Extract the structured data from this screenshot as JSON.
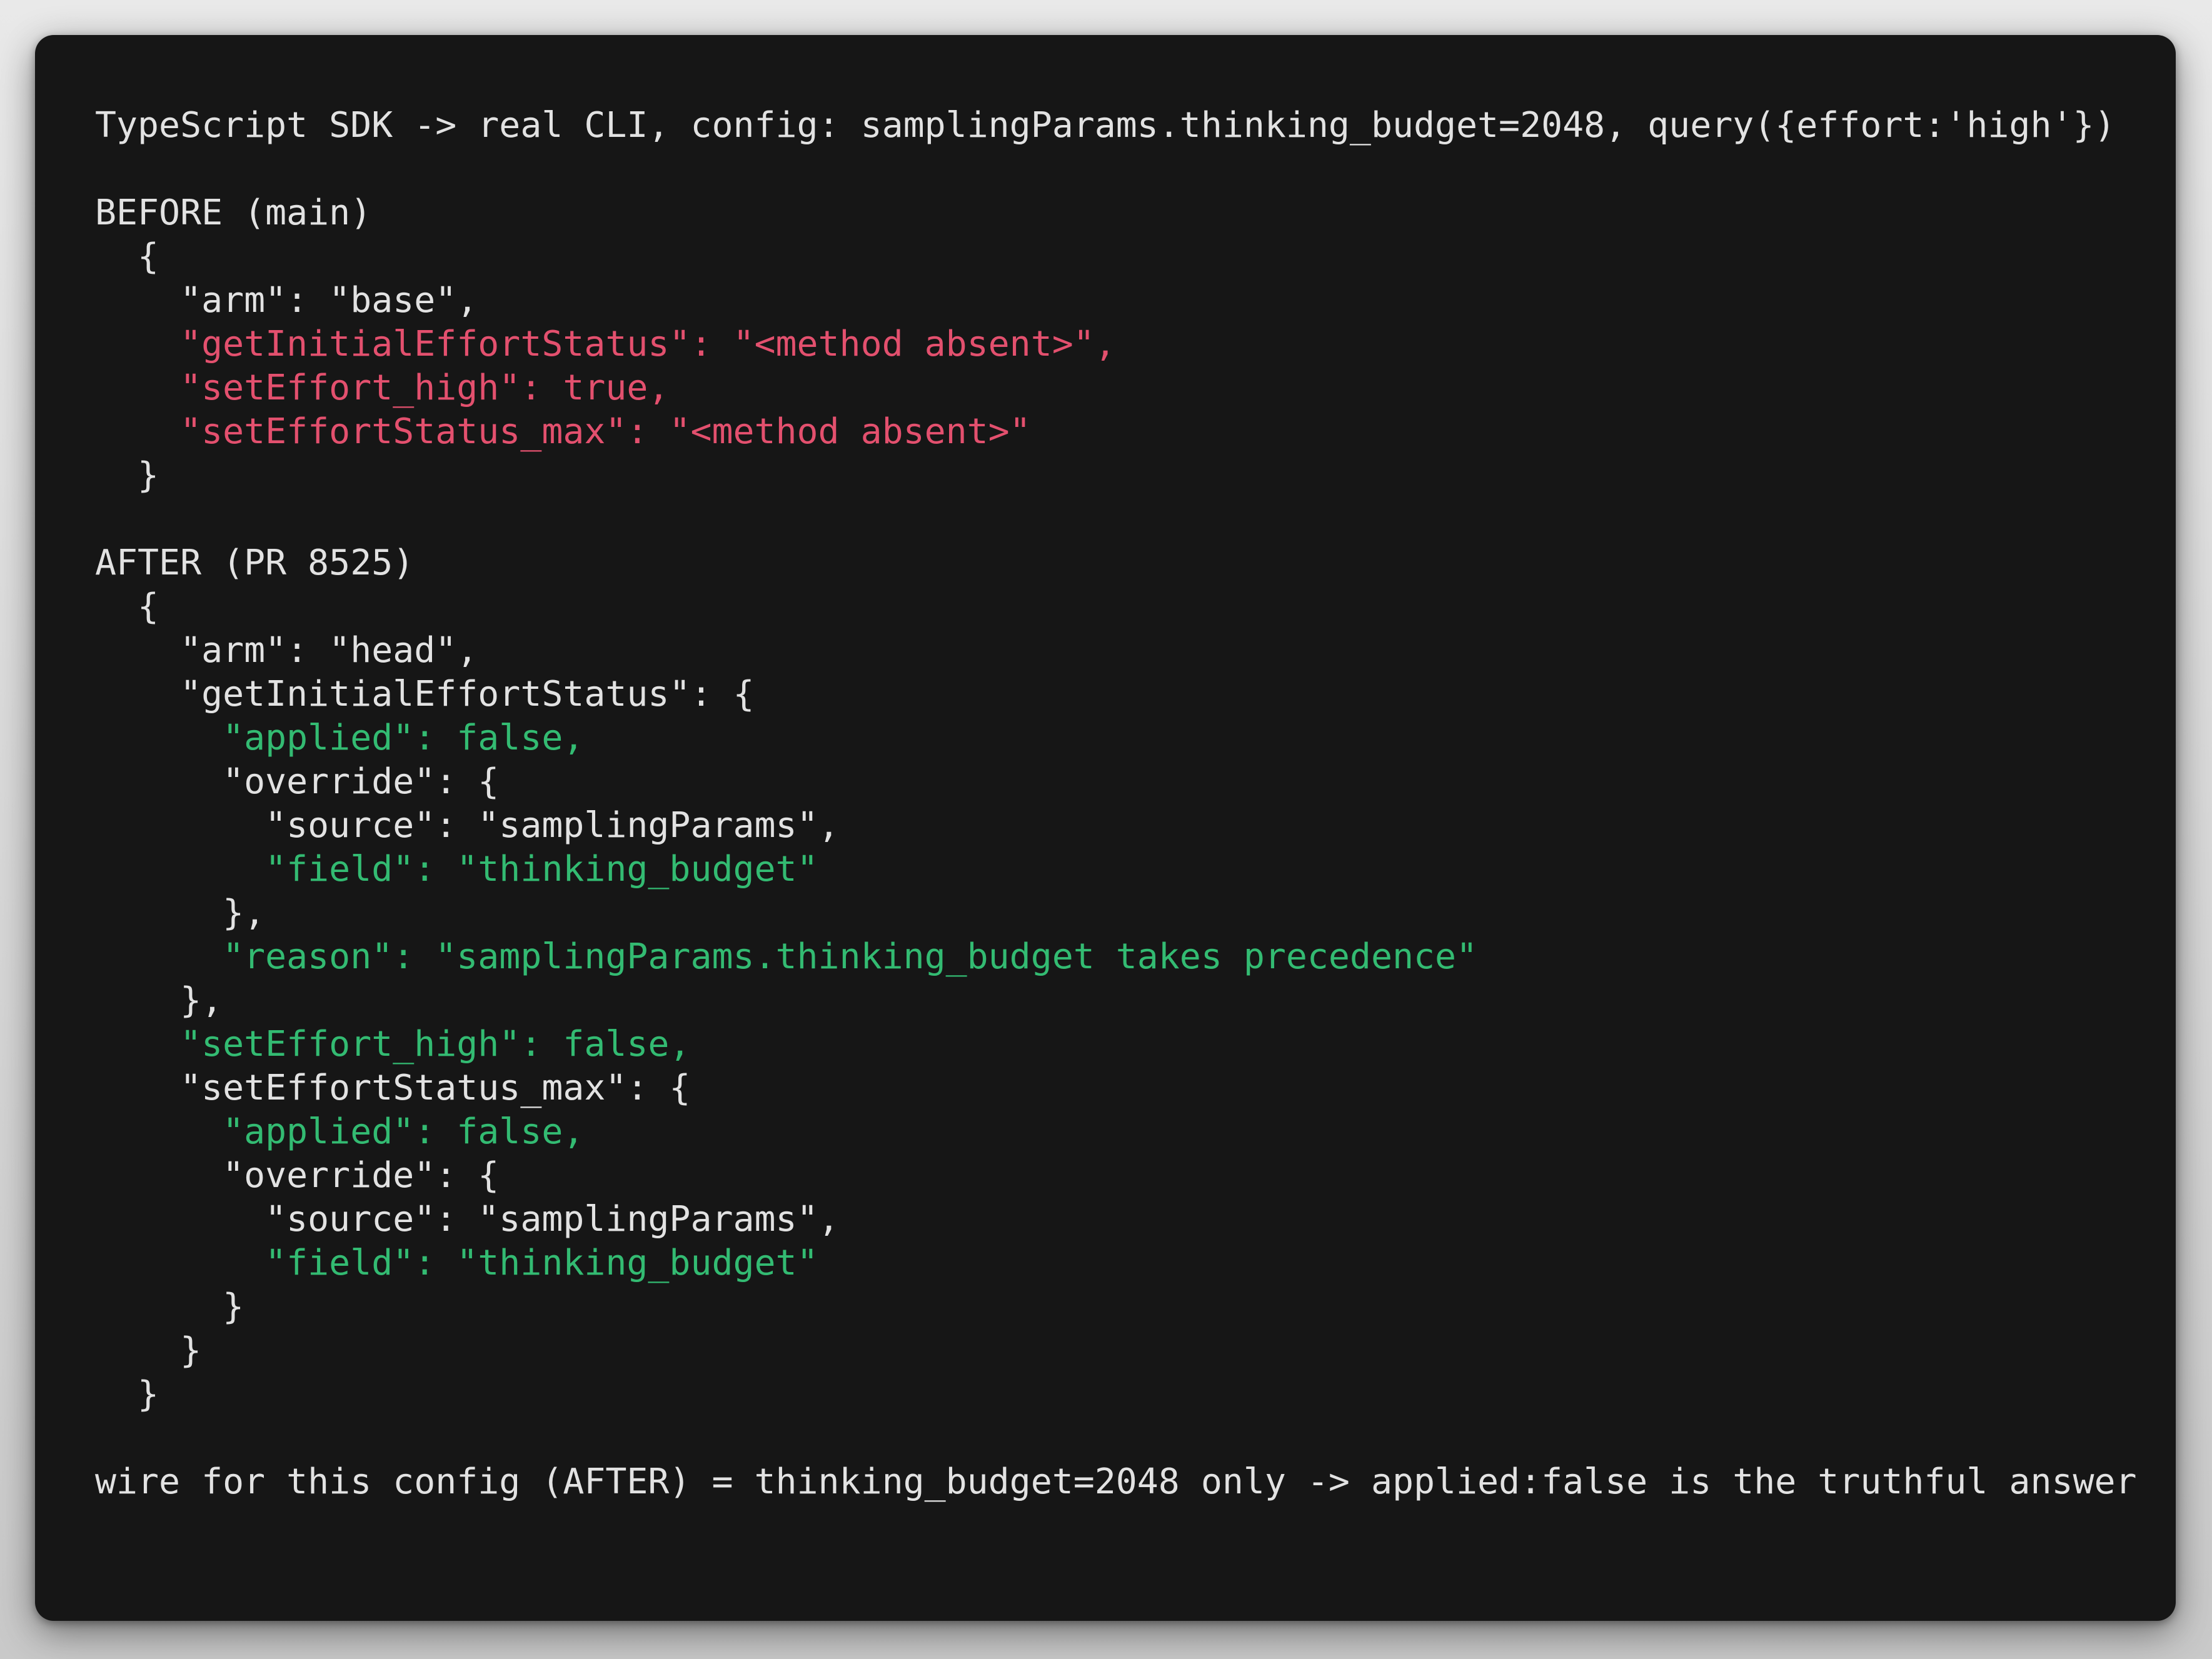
{
  "colors": {
    "background": "#161616",
    "default": "#e2e2e2",
    "removed": "#e3506e",
    "changed": "#33bb72"
  },
  "terminal": {
    "lines": [
      {
        "text": "TypeScript SDK -> real CLI, config: samplingParams.thinking_budget=2048, query({effort:'high'})",
        "tone": "default"
      },
      {
        "text": "",
        "tone": "default"
      },
      {
        "text": "BEFORE (main)",
        "tone": "default"
      },
      {
        "text": "  {",
        "tone": "default"
      },
      {
        "text": "    \"arm\": \"base\",",
        "tone": "default"
      },
      {
        "text": "    \"getInitialEffortStatus\": \"<method absent>\",",
        "tone": "removed"
      },
      {
        "text": "    \"setEffort_high\": true,",
        "tone": "removed"
      },
      {
        "text": "    \"setEffortStatus_max\": \"<method absent>\"",
        "tone": "removed"
      },
      {
        "text": "  }",
        "tone": "default"
      },
      {
        "text": "",
        "tone": "default"
      },
      {
        "text": "AFTER (PR 8525)",
        "tone": "default"
      },
      {
        "text": "  {",
        "tone": "default"
      },
      {
        "text": "    \"arm\": \"head\",",
        "tone": "default"
      },
      {
        "text": "    \"getInitialEffortStatus\": {",
        "tone": "default"
      },
      {
        "text": "      \"applied\": false,",
        "tone": "changed"
      },
      {
        "text": "      \"override\": {",
        "tone": "default"
      },
      {
        "text": "        \"source\": \"samplingParams\",",
        "tone": "default"
      },
      {
        "text": "        \"field\": \"thinking_budget\"",
        "tone": "changed"
      },
      {
        "text": "      },",
        "tone": "default"
      },
      {
        "text": "      \"reason\": \"samplingParams.thinking_budget takes precedence\"",
        "tone": "changed"
      },
      {
        "text": "    },",
        "tone": "default"
      },
      {
        "text": "    \"setEffort_high\": false,",
        "tone": "changed"
      },
      {
        "text": "    \"setEffortStatus_max\": {",
        "tone": "default"
      },
      {
        "text": "      \"applied\": false,",
        "tone": "changed"
      },
      {
        "text": "      \"override\": {",
        "tone": "default"
      },
      {
        "text": "        \"source\": \"samplingParams\",",
        "tone": "default"
      },
      {
        "text": "        \"field\": \"thinking_budget\"",
        "tone": "changed"
      },
      {
        "text": "      }",
        "tone": "default"
      },
      {
        "text": "    }",
        "tone": "default"
      },
      {
        "text": "  }",
        "tone": "default"
      },
      {
        "text": "",
        "tone": "default"
      },
      {
        "text": "wire for this config (AFTER) = thinking_budget=2048 only -> applied:false is the truthful answer",
        "tone": "default"
      }
    ]
  }
}
